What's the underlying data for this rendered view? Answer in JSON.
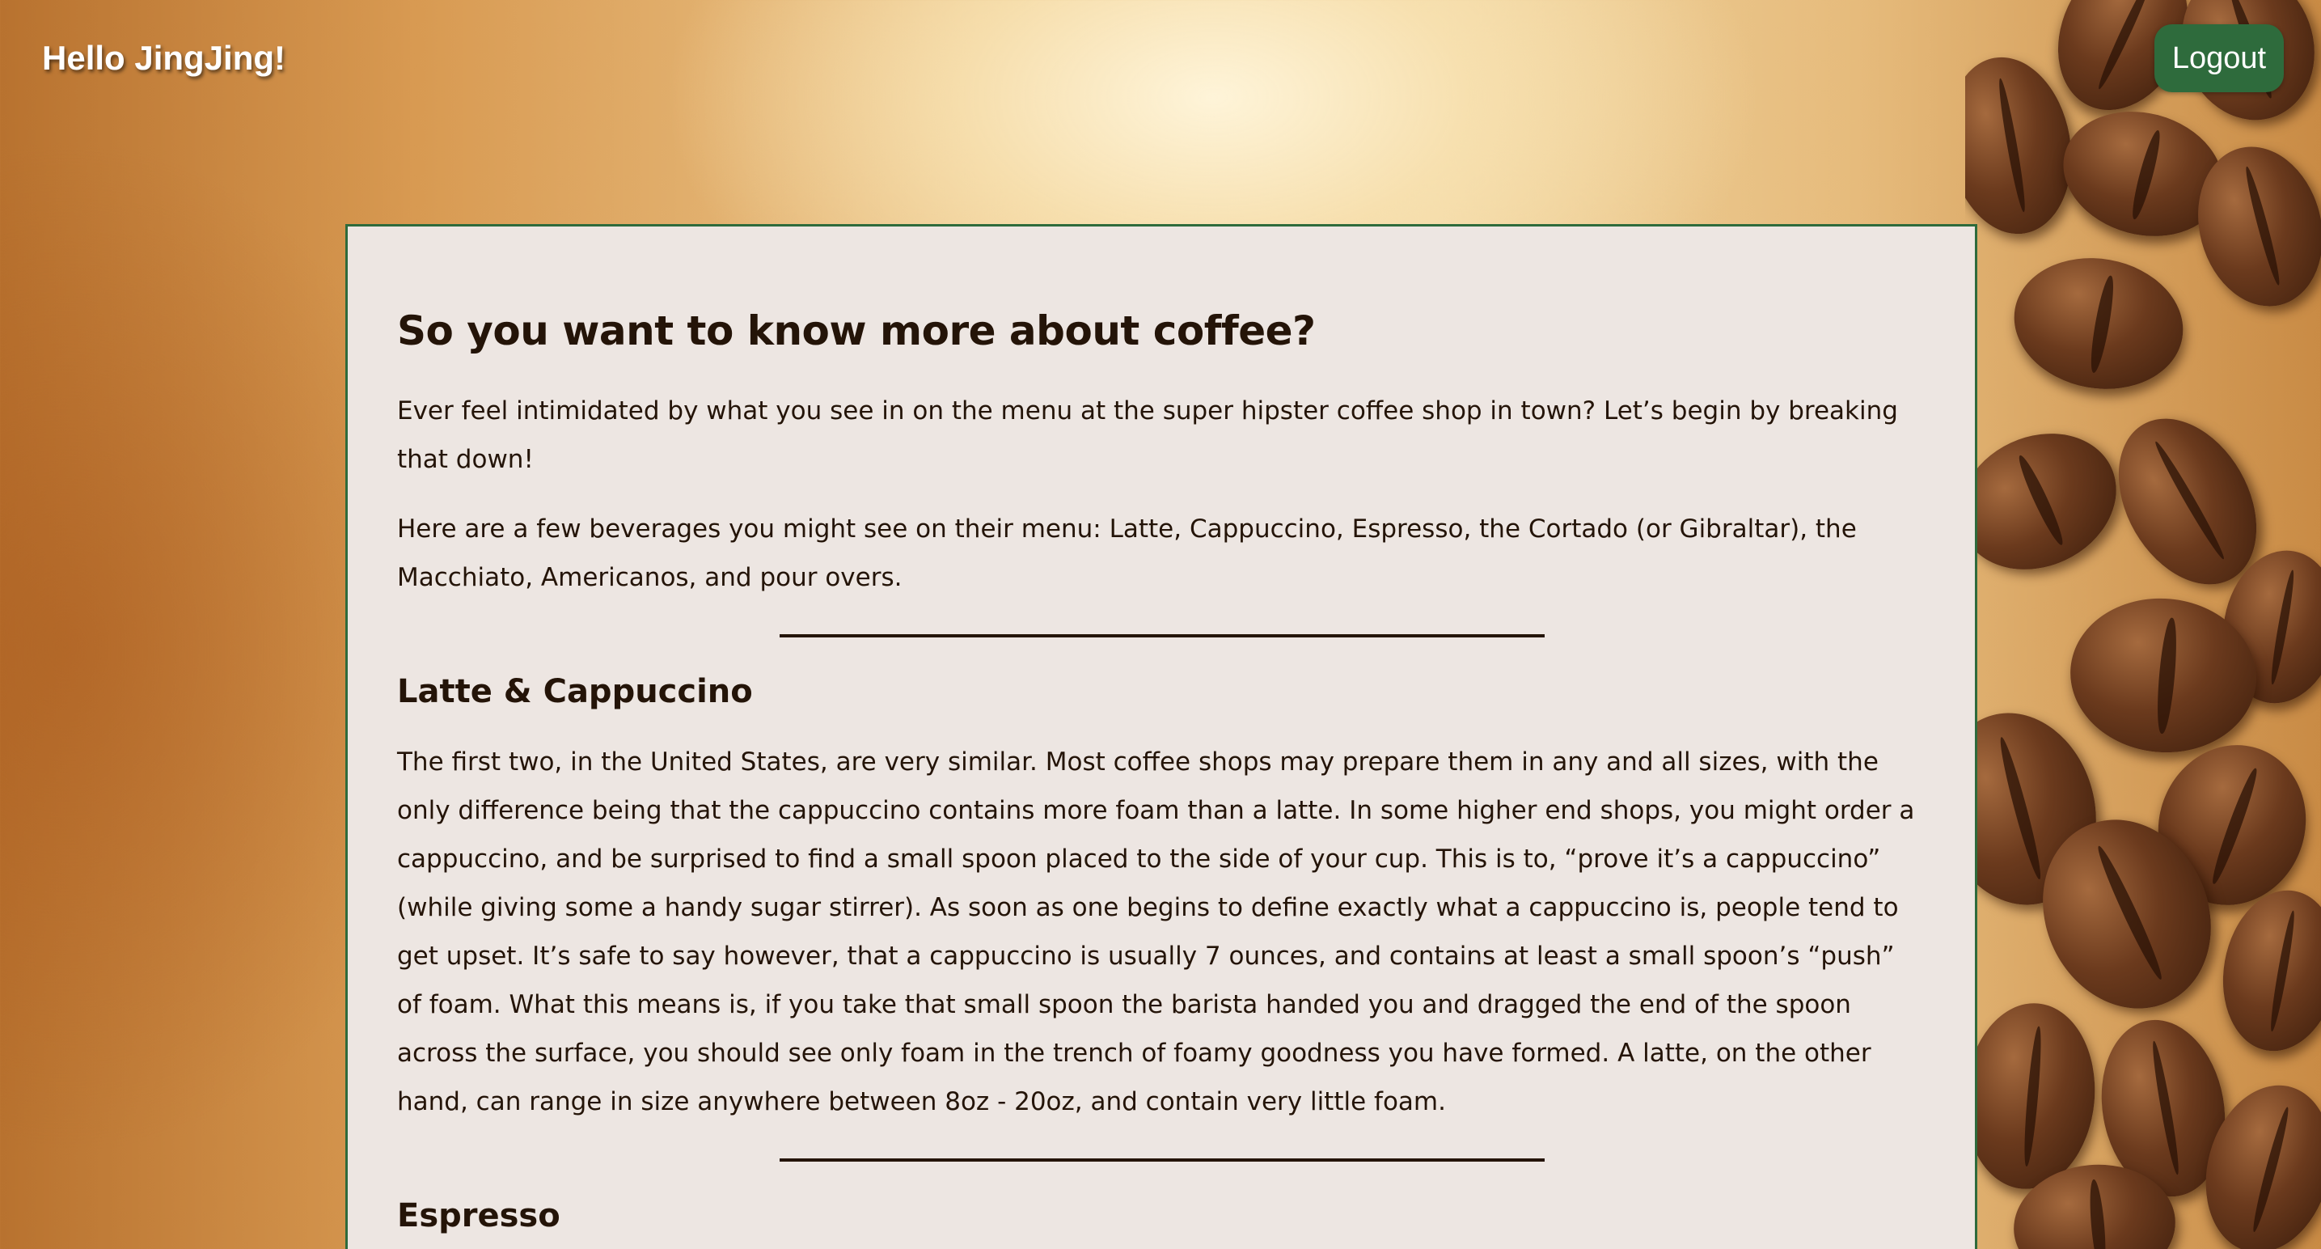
{
  "header": {
    "greeting": "Hello JingJing!",
    "logout_label": "Logout"
  },
  "article": {
    "title": "So you want to know more about coffee?",
    "intro_paragraphs": [
      "Ever feel intimidated by what you see in on the menu at the super hipster coffee shop in town? Let’s begin by breaking that down!",
      "Here are a few beverages you might see on their menu: Latte, Cappuccino, Espresso, the Cortado (or Gibraltar), the Macchiato, Americanos, and pour overs."
    ],
    "sections": [
      {
        "heading": "Latte & Cappuccino",
        "body": "The first two, in the United States, are very similar. Most coffee shops may prepare them in any and all sizes, with the only difference being that the cappuccino contains more foam than a latte. In some higher end shops, you might order a cappuccino, and be surprised to find a small spoon placed to the side of your cup. This is to, “prove it’s a cappuccino” (while giving some a handy sugar stirrer). As soon as one begins to define exactly what a cappuccino is, people tend to get upset. It’s safe to say however, that a cappuccino is usually 7 ounces, and contains at least a small spoon’s “push” of foam. What this means is, if you take that small spoon the barista handed you and dragged the end of the spoon across the surface, you should see only foam in the trench of foamy goodness you have formed. A latte, on the other hand, can range in size anywhere between 8oz - 20oz, and contain very little foam."
      },
      {
        "heading": "Espresso"
      }
    ]
  },
  "colors": {
    "accent_green": "#2e6b3c",
    "card_background": "#ede6e2",
    "text_dark": "#241408"
  },
  "icons": [
    "coffee-beans-decoration"
  ]
}
